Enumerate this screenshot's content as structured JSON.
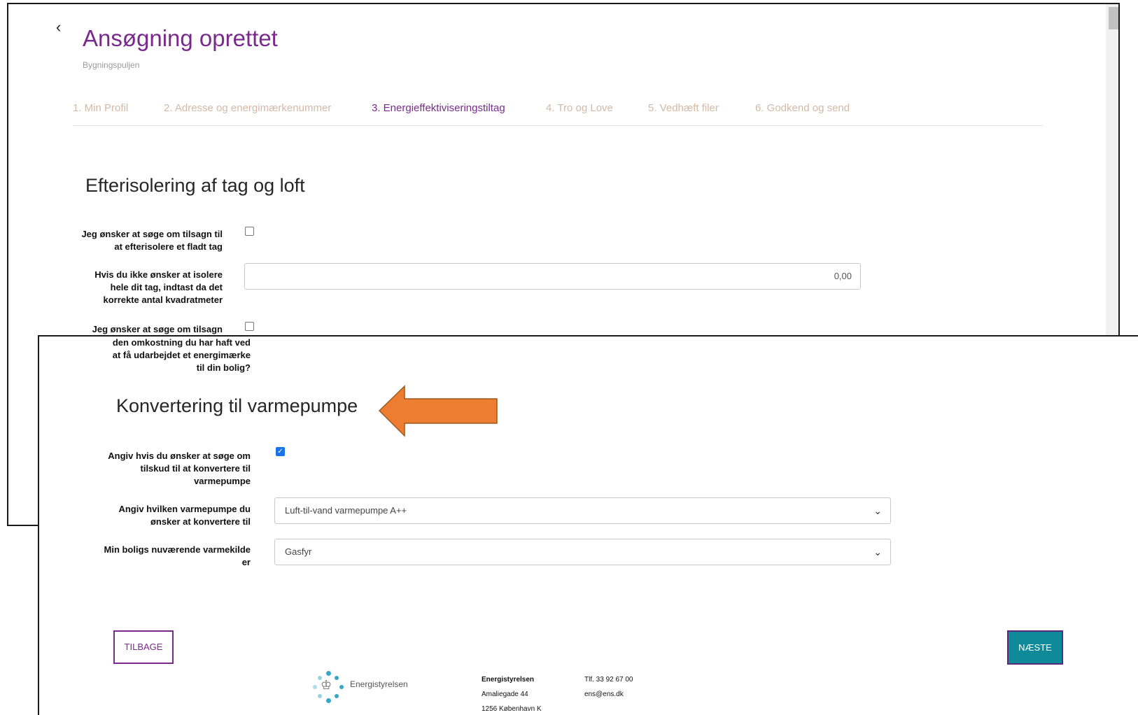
{
  "header": {
    "back_icon": "chevron-left-icon",
    "title": "Ansøgning oprettet",
    "subtitle": "Bygningspuljen"
  },
  "steps": [
    {
      "label": "1. Min Profil",
      "active": false
    },
    {
      "label": "2. Adresse og energimærkenummer",
      "active": false
    },
    {
      "label": "3. Energieffektiviseringstiltag",
      "active": true
    },
    {
      "label": "4. Tro og Love",
      "active": false
    },
    {
      "label": "5. Vedhæft filer",
      "active": false
    },
    {
      "label": "6. Godkend og send",
      "active": false
    }
  ],
  "roof_section": {
    "title": "Efterisolering af tag og loft",
    "flat_roof_label": "Jeg ønsker at søge om tilsagn til at efterisolere et fladt tag",
    "flat_roof_checked": false,
    "area_label": "Hvis du ikke ønsker at isolere hele dit tag, indtast da det korrekte antal kvadratmeter",
    "area_value": "0,00",
    "energy_label_label_part1": "Jeg ønsker at søge om tilsagn",
    "energy_label_label_part2": "den omkostning du har haft ved at få udarbejdet et energimærke til din bolig?",
    "energy_label_checked": false
  },
  "heatpump_section": {
    "title": "Konvertering til varmepumpe",
    "convert_label": "Angiv hvis du ønsker at søge om tilskud til at konvertere til varmepumpe",
    "convert_checked": true,
    "pump_type_label": "Angiv hvilken varmepumpe du ønsker at konvertere til",
    "pump_type_value": "Luft-til-vand varmepumpe A++",
    "current_source_label": "Min boligs nuværende varmekilde er",
    "current_source_value": "Gasfyr"
  },
  "buttons": {
    "back": "TILBAGE",
    "next": "NÆSTE"
  },
  "footer": {
    "logo_text": "Energistyrelsen",
    "org_name": "Energistyrelsen",
    "street": "Amaliegade 44",
    "city": "1256 København K",
    "phone": "Tlf. 33 92 67 00",
    "email": "ens@ens.dk"
  },
  "colors": {
    "accent_purple": "#7a2a8c",
    "next_button": "#0f8a9a",
    "annotation_arrow": "#ed7d31",
    "inactive_step": "#d4b9a6"
  }
}
